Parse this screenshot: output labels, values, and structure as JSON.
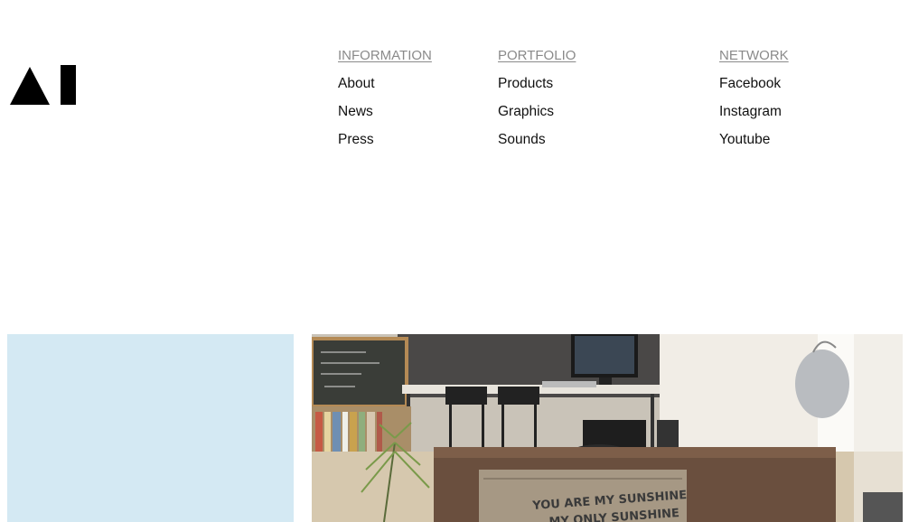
{
  "logo": {
    "icon": "ai-triangle-bar-logo",
    "alt": "AI"
  },
  "nav": {
    "columns": [
      {
        "heading": "INFORMATION",
        "links": [
          "About",
          "News",
          "Press"
        ]
      },
      {
        "heading": "PORTFOLIO",
        "links": [
          "Products",
          "Graphics",
          "Sounds"
        ]
      },
      {
        "heading": "NETWORK",
        "links": [
          "Facebook",
          "Instagram",
          "Youtube"
        ]
      }
    ]
  },
  "panels": {
    "left_color": "#d4e9f3"
  },
  "photo": {
    "pillow_text_1": "YOU ARE MY SUNSHINE",
    "pillow_text_2": "MY ONLY SUNSHINE"
  },
  "colors": {
    "heading_gray": "#8a8a8a",
    "link_text": "#111111"
  }
}
